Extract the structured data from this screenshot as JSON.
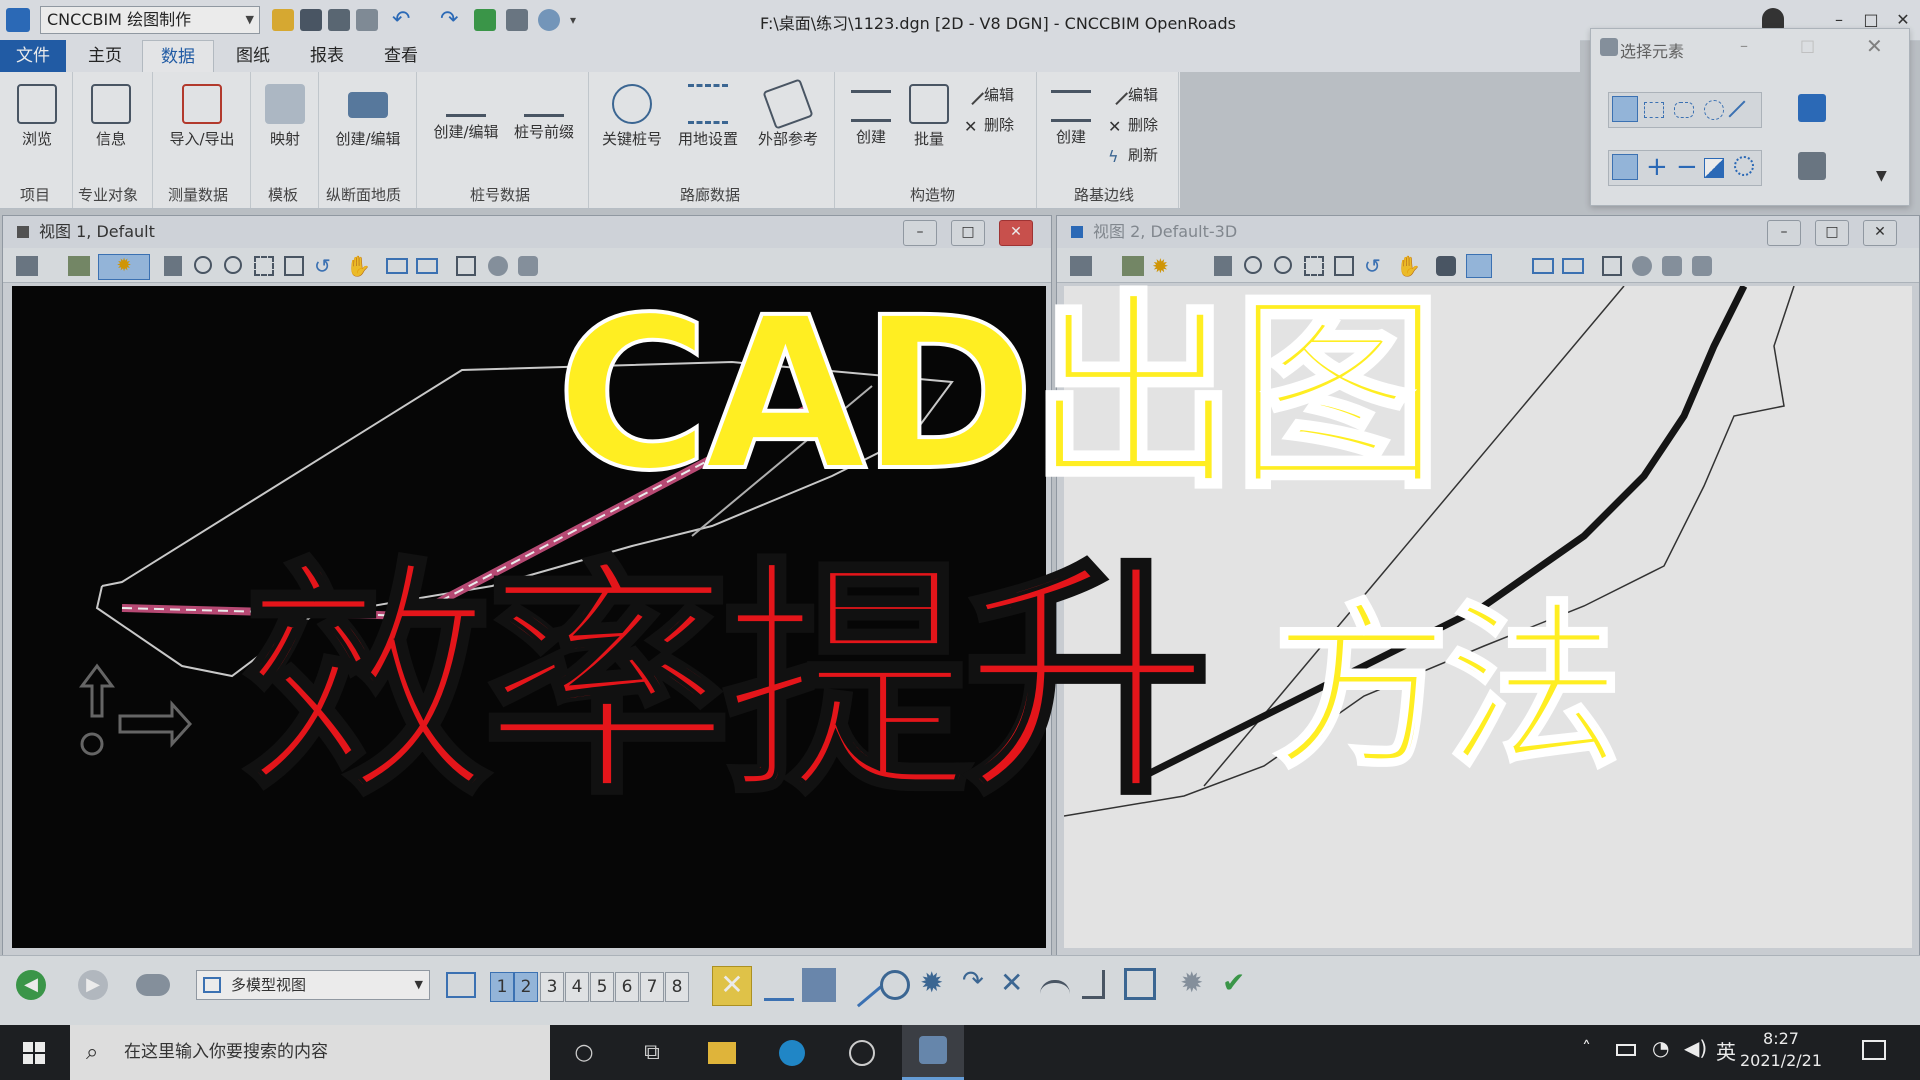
{
  "titlebar": {
    "workspace": "CNCCBIM 绘图制作",
    "title": "F:\\桌面\\练习\\1123.dgn [2D - V8 DGN] - CNCCBIM OpenRoads"
  },
  "menu": {
    "file": "文件",
    "tabs": [
      "主页",
      "数据",
      "图纸",
      "报表",
      "查看"
    ]
  },
  "ribbon": {
    "groups": {
      "project": "项目",
      "special_objects": "专业对象",
      "survey_data": "测量数据",
      "template": "模板",
      "profile_geology": "纵断面地质",
      "station_data": "桩号数据",
      "road_data": "路廊数据",
      "structures": "构造物",
      "subgrade_edge": "路基边线"
    },
    "buttons": {
      "browse": "浏览",
      "info": "信息",
      "import_export": "导入/导出",
      "map": "映射",
      "create_edit_1": "创建/编辑",
      "create_edit_2": "创建/编辑",
      "station_prefix": "桩号前缀",
      "key_station": "关键桩号",
      "land_setting": "用地设置",
      "external_ref": "外部参考",
      "create_1": "创建",
      "batch": "批量",
      "edit_1": "编辑",
      "delete_1": "删除",
      "create_2": "创建",
      "edit_2": "编辑",
      "delete_2": "删除",
      "refresh": "刷新"
    }
  },
  "selection_panel": {
    "title": "选择元素"
  },
  "views": {
    "view1_title": "视图 1, Default",
    "view2_title": "视图 2, Default-3D"
  },
  "statusbar": {
    "view_combo": "多模型视图",
    "view_numbers": [
      "1",
      "2",
      "3",
      "4",
      "5",
      "6",
      "7",
      "8"
    ]
  },
  "taskbar": {
    "search_placeholder": "在这里输入你要搜索的内容",
    "ime": "英",
    "time": "8:27",
    "date": "2021/2/21"
  },
  "overlay": {
    "line1": "CAD出图",
    "line2": "效率提升",
    "line3": "方法"
  },
  "colors": {
    "accent_blue": "#1f5fb0",
    "title_yellow": "#ffee22",
    "title_red": "#e4151a"
  }
}
